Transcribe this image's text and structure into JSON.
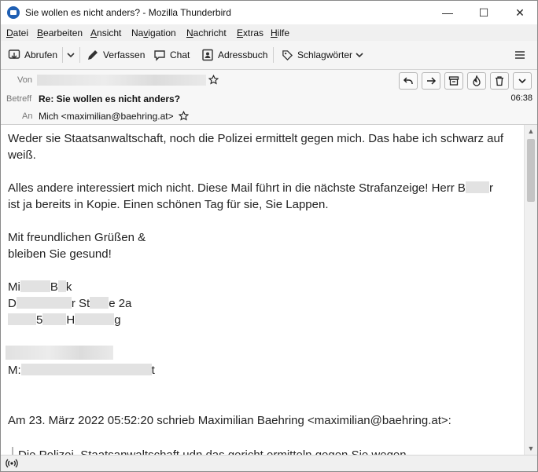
{
  "window": {
    "title": "Sie wollen es nicht anders? - Mozilla Thunderbird"
  },
  "menubar": [
    {
      "label": "Datei",
      "accel": "D",
      "rest": "atei"
    },
    {
      "label": "Bearbeiten",
      "accel": "B",
      "rest": "earbeiten"
    },
    {
      "label": "Ansicht",
      "accel": "A",
      "rest": "nsicht"
    },
    {
      "label": "Navigation",
      "pre": "Na",
      "accel": "v",
      "rest": "igation"
    },
    {
      "label": "Nachricht",
      "accel": "N",
      "rest": "achricht"
    },
    {
      "label": "Extras",
      "accel": "E",
      "rest": "xtras"
    },
    {
      "label": "Hilfe",
      "accel": "H",
      "rest": "ilfe"
    }
  ],
  "toolbar": {
    "get_messages": "Abrufen",
    "compose": "Verfassen",
    "chat": "Chat",
    "address_book": "Adressbuch",
    "tags": "Schlagwörter"
  },
  "header": {
    "from_label": "Von",
    "subject_label": "Betreff",
    "subject": "Re: Sie wollen es nicht anders?",
    "to_label": "An",
    "to": "Mich <maximilian@baehring.at>",
    "time": "06:38"
  },
  "body": {
    "line1": "Weder sie Staatsanwaltschaft, noch die Polizei ermittelt gegen mich. Das habe ich schwarz auf",
    "line2": "weiß.",
    "line3a": "Alles andere interessiert mich nicht. Diese Mail führt in die nächste Strafanzeige! Herr B",
    "line3b": "r",
    "line4": "ist ja bereits in Kopie. Einen schönen Tag für sie, Sie Lappen.",
    "line5": "Mit freundlichen Grüßen &",
    "line6": "bleiben Sie gesund!",
    "sig1a": "Mi",
    "sig1b": "B",
    "sig1c": "k",
    "sig2a": "D",
    "sig2b": "r St",
    "sig2c": "e 2a",
    "sig3a": "5",
    "sig3b": "H",
    "sig3c": "g",
    "sig5a": "M:",
    "sig5b": "t",
    "reply_header": "Am 23. März 2022 05:52:20 schrieb Maximilian Baehring <maximilian@baehring.at>:",
    "quoted": "Die Polizei, Staatsanwaltschaft udn das gericht ermitteln gegen Sie wegen"
  }
}
